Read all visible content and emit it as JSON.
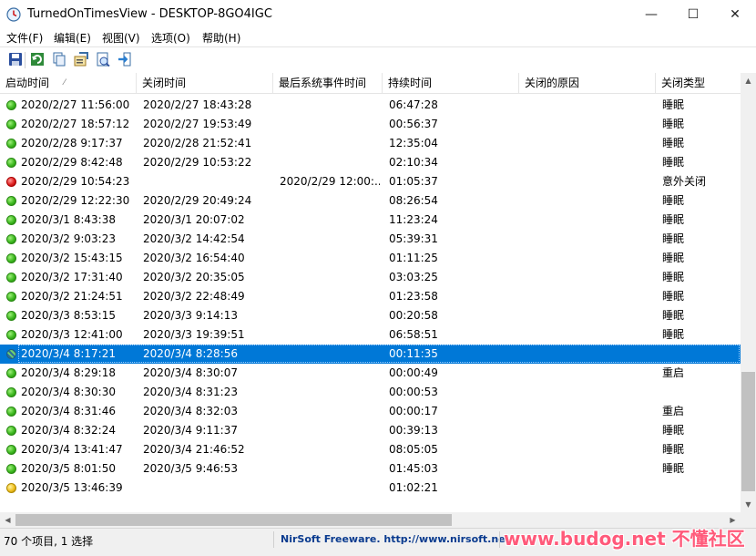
{
  "window": {
    "title": "TurnedOnTimesView  -  DESKTOP-8GO4IGC",
    "minimize_label": "—",
    "maximize_label": "☐",
    "close_label": "✕"
  },
  "menu": [
    "文件(F)",
    "编辑(E)",
    "视图(V)",
    "选项(O)",
    "帮助(H)"
  ],
  "toolbar": [
    "save-icon",
    "refresh-icon",
    "copy-icon",
    "properties-icon",
    "html-report-icon",
    "exit-icon"
  ],
  "columns": [
    "启动时间",
    "关闭时间",
    "最后系统事件时间",
    "持续时间",
    "关闭的原因",
    "关闭类型"
  ],
  "sort_indicator": "⁄",
  "rows": [
    {
      "status": "green",
      "start": "2020/2/27 11:56:00",
      "stop": "2020/2/27 18:43:28",
      "last_event": "",
      "duration": "06:47:28",
      "reason": "",
      "type": "睡眠"
    },
    {
      "status": "green",
      "start": "2020/2/27 18:57:12",
      "stop": "2020/2/27 19:53:49",
      "last_event": "",
      "duration": "00:56:37",
      "reason": "",
      "type": "睡眠"
    },
    {
      "status": "green",
      "start": "2020/2/28 9:17:37",
      "stop": "2020/2/28 21:52:41",
      "last_event": "",
      "duration": "12:35:04",
      "reason": "",
      "type": "睡眠"
    },
    {
      "status": "green",
      "start": "2020/2/29 8:42:48",
      "stop": "2020/2/29 10:53:22",
      "last_event": "",
      "duration": "02:10:34",
      "reason": "",
      "type": "睡眠"
    },
    {
      "status": "red",
      "start": "2020/2/29 10:54:23",
      "stop": "",
      "last_event": "2020/2/29 12:00:...",
      "duration": "01:05:37",
      "reason": "",
      "type": "意外关闭"
    },
    {
      "status": "green",
      "start": "2020/2/29 12:22:30",
      "stop": "2020/2/29 20:49:24",
      "last_event": "",
      "duration": "08:26:54",
      "reason": "",
      "type": "睡眠"
    },
    {
      "status": "green",
      "start": "2020/3/1 8:43:38",
      "stop": "2020/3/1 20:07:02",
      "last_event": "",
      "duration": "11:23:24",
      "reason": "",
      "type": "睡眠"
    },
    {
      "status": "green",
      "start": "2020/3/2 9:03:23",
      "stop": "2020/3/2 14:42:54",
      "last_event": "",
      "duration": "05:39:31",
      "reason": "",
      "type": "睡眠"
    },
    {
      "status": "green",
      "start": "2020/3/2 15:43:15",
      "stop": "2020/3/2 16:54:40",
      "last_event": "",
      "duration": "01:11:25",
      "reason": "",
      "type": "睡眠"
    },
    {
      "status": "green",
      "start": "2020/3/2 17:31:40",
      "stop": "2020/3/2 20:35:05",
      "last_event": "",
      "duration": "03:03:25",
      "reason": "",
      "type": "睡眠"
    },
    {
      "status": "green",
      "start": "2020/3/2 21:24:51",
      "stop": "2020/3/2 22:48:49",
      "last_event": "",
      "duration": "01:23:58",
      "reason": "",
      "type": "睡眠"
    },
    {
      "status": "green",
      "start": "2020/3/3 8:53:15",
      "stop": "2020/3/3 9:14:13",
      "last_event": "",
      "duration": "00:20:58",
      "reason": "",
      "type": "睡眠"
    },
    {
      "status": "green",
      "start": "2020/3/3 12:41:00",
      "stop": "2020/3/3 19:39:51",
      "last_event": "",
      "duration": "06:58:51",
      "reason": "",
      "type": "睡眠"
    },
    {
      "status": "hatched",
      "selected": true,
      "start": "2020/3/4 8:17:21",
      "stop": "2020/3/4 8:28:56",
      "last_event": "",
      "duration": "00:11:35",
      "reason": "",
      "type": ""
    },
    {
      "status": "green",
      "start": "2020/3/4 8:29:18",
      "stop": "2020/3/4 8:30:07",
      "last_event": "",
      "duration": "00:00:49",
      "reason": "",
      "type": "重启"
    },
    {
      "status": "green",
      "start": "2020/3/4 8:30:30",
      "stop": "2020/3/4 8:31:23",
      "last_event": "",
      "duration": "00:00:53",
      "reason": "",
      "type": ""
    },
    {
      "status": "green",
      "start": "2020/3/4 8:31:46",
      "stop": "2020/3/4 8:32:03",
      "last_event": "",
      "duration": "00:00:17",
      "reason": "",
      "type": "重启"
    },
    {
      "status": "green",
      "start": "2020/3/4 8:32:24",
      "stop": "2020/3/4 9:11:37",
      "last_event": "",
      "duration": "00:39:13",
      "reason": "",
      "type": "睡眠"
    },
    {
      "status": "green",
      "start": "2020/3/4 13:41:47",
      "stop": "2020/3/4 21:46:52",
      "last_event": "",
      "duration": "08:05:05",
      "reason": "",
      "type": "睡眠"
    },
    {
      "status": "green",
      "start": "2020/3/5 8:01:50",
      "stop": "2020/3/5 9:46:53",
      "last_event": "",
      "duration": "01:45:03",
      "reason": "",
      "type": "睡眠"
    },
    {
      "status": "yellow",
      "start": "2020/3/5 13:46:39",
      "stop": "",
      "last_event": "",
      "duration": "01:02:21",
      "reason": "",
      "type": ""
    }
  ],
  "scroll_arrows": {
    "up": "▲",
    "down": "▼",
    "left": "◀",
    "right": "▶"
  },
  "status": {
    "count": "70 个项目, 1 选择",
    "credit": "NirSoft Freeware.  http://www.nirsoft.net"
  },
  "watermark": "www.budog.net 不懂社区",
  "colors": {
    "selection": "#0078d7",
    "credit_text": "#0a3b8f",
    "watermark": "#ff5a7a"
  }
}
